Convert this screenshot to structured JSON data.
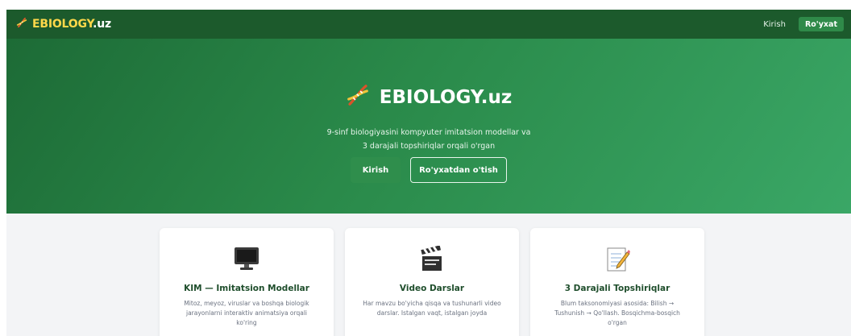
{
  "navbar": {
    "brand_highlight": "EBIOLOGY",
    "brand_rest": ".uz",
    "brand_icon": "dna-icon",
    "login_label": "Kirish",
    "register_label": "Ro'yxat"
  },
  "hero": {
    "title": "EBIOLOGY.uz",
    "title_icon": "dna-icon",
    "subtitle_line1": "9-sinf biologiyasini kompyuter imitatsion modellar va",
    "subtitle_line2": "3 darajali topshiriqlar orqali o'rgan",
    "login_button": "Kirish",
    "register_button": "Ro'yxatdan o'tish"
  },
  "features": [
    {
      "icon": "monitor-icon",
      "title": "KIM — Imitatsion Modellar",
      "desc": "Mitoz, meyoz, viruslar va boshqa biologik jarayonlarni interaktiv animatsiya orqali ko'ring"
    },
    {
      "icon": "clapperboard-icon",
      "title": "Video Darslar",
      "desc": "Har mavzu bo'yicha qisqa va tushunarli video darslar. Istalgan vaqt, istalgan joyda"
    },
    {
      "icon": "memo-icon",
      "title": "3 Darajali Topshiriqlar",
      "desc": "Blum taksonomiyasi asosida: Bilish → Tushunish → Qo'llash. Bosqichma-bosqich o'rgan"
    }
  ],
  "colors": {
    "navbar": "#1c5a2c",
    "brand_accent": "#ffd84a",
    "hero_start": "#1d6b36",
    "hero_end": "#3aa766",
    "card_title": "#1f4e2c"
  }
}
